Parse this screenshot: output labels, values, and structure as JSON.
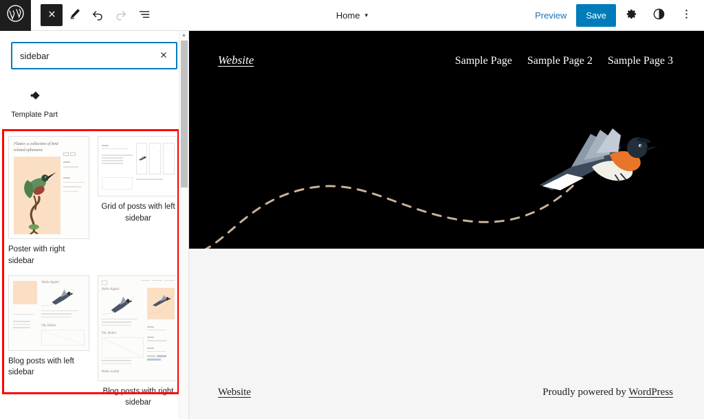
{
  "topbar": {
    "logo_icon": "wordpress-logo-icon",
    "close_label": "Close",
    "close_icon": "close-x-icon",
    "edit_icon": "pencil-edit-icon",
    "undo_icon": "undo-arrow-icon",
    "redo_icon": "redo-arrow-icon",
    "listview_icon": "list-view-icon",
    "document_title": "Home",
    "document_caret": "▾",
    "preview_label": "Preview",
    "save_label": "Save",
    "settings_icon": "gear-icon",
    "styles_icon": "contrast-half-circle-icon",
    "more_icon": "three-dots-vertical-icon",
    "save_color": "#007cba",
    "preview_color": "#2271b1"
  },
  "inserter": {
    "search": {
      "value": "sidebar",
      "placeholder": "Search",
      "clear_icon": "close-x-icon",
      "focus_color": "#007cba"
    },
    "blocks": [
      {
        "label": "Template Part",
        "icon": "template-part-icon"
      }
    ],
    "patterns_highlight_color": "#ff0000",
    "patterns": [
      {
        "label": "Poster with right sidebar",
        "preview": {
          "title": "Flutter, a collection of bird related ephemera",
          "meta": [
            {
              "heading": "Date",
              "lines": [
                "February 11 2021"
              ]
            },
            {
              "heading": "Location",
              "lines": [
                "New Britain Museum",
                "272 Benton Avenue",
                "Rhinebeck NY 12402"
              ]
            }
          ],
          "accent": "#fbdfc4"
        }
      },
      {
        "label": "Grid of posts with left sidebar",
        "preview": {
          "accent": "#ffffff"
        }
      },
      {
        "label": "Blog posts with left sidebar",
        "preview": {
          "headings": [
            "Hello Again!",
            "Oh, Hello!"
          ],
          "accent": "#fbdfc4"
        }
      },
      {
        "label": "Blog posts with right sidebar",
        "preview": {
          "headings": [
            "Hello Again!",
            "Oh, Hello!",
            "Hello world!"
          ],
          "nav": [
            "Sample Page",
            "Sample Page 2",
            "Sample Page 3"
          ],
          "sidebar_headings": [
            "Archives",
            "Categories",
            "Tags"
          ],
          "accent": "#fbdfc4"
        }
      }
    ],
    "scrollbar": {
      "up_arrow": "▲"
    }
  },
  "canvas": {
    "header": {
      "brand": "Website",
      "nav": [
        "Sample Page",
        "Sample Page 2",
        "Sample Page 3"
      ],
      "background": "#000000",
      "art": "flying-bird-with-dashed-trail"
    },
    "footer": {
      "brand": "Website",
      "credit_prefix": "Proudly powered by ",
      "credit_link": "WordPress",
      "background": "#f5f5f5"
    }
  }
}
